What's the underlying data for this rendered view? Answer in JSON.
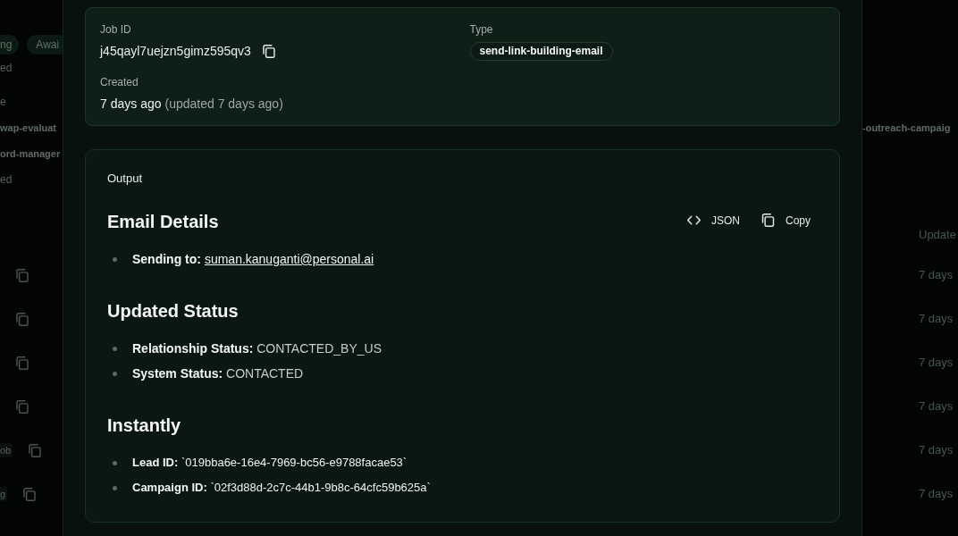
{
  "background": {
    "filter_chips": [
      "ng",
      "Awai"
    ],
    "left_texts": [
      {
        "text": "ed",
        "kind": "meta"
      },
      {
        "text": "e",
        "kind": "meta"
      },
      {
        "text": "wap-evaluat",
        "kind": "title"
      },
      {
        "text": "ord-manager",
        "kind": "title"
      },
      {
        "text": "ed",
        "kind": "meta"
      }
    ],
    "right_texts": [
      {
        "text": "-outreach-campaig",
        "kind": "title"
      }
    ],
    "table": {
      "column_header": "Update",
      "rows": [
        {
          "updated": "7 days"
        },
        {
          "updated": "7 days"
        },
        {
          "updated": "7 days"
        },
        {
          "updated": "7 days"
        },
        {
          "id_fragment": "ob",
          "updated": "7 days"
        },
        {
          "id_fragment": "g",
          "updated": "7 days"
        }
      ]
    }
  },
  "job": {
    "job_id_label": "Job ID",
    "job_id": "j45qayl7uejzn5gimz595qv3",
    "type_label": "Type",
    "type": "send-link-building-email",
    "created_label": "Created",
    "created": "7 days ago",
    "updated": "(updated 7 days ago)"
  },
  "output": {
    "title": "Output",
    "buttons": [
      {
        "kind": "json",
        "label": "JSON"
      },
      {
        "kind": "copy",
        "label": "Copy"
      }
    ],
    "sections": [
      {
        "heading": "Email Details",
        "items": [
          {
            "kind": "link",
            "label": "Sending to:",
            "value": "suman.kanuganti@personal.ai"
          }
        ]
      },
      {
        "heading": "Updated Status",
        "items": [
          {
            "kind": "plain",
            "label": "Relationship Status:",
            "value": "CONTACTED_BY_US"
          },
          {
            "kind": "plain",
            "label": "System Status:",
            "value": "CONTACTED"
          }
        ]
      },
      {
        "heading": "Instantly",
        "items": [
          {
            "kind": "code",
            "label": "Lead ID:",
            "value": "`019bba6e-16e4-7969-bc56-e9788facae53`"
          },
          {
            "kind": "code",
            "label": "Campaign ID:",
            "value": "`02f3d88d-2c7c-44b1-9b8c-64cfc59b625a`"
          }
        ]
      }
    ]
  }
}
